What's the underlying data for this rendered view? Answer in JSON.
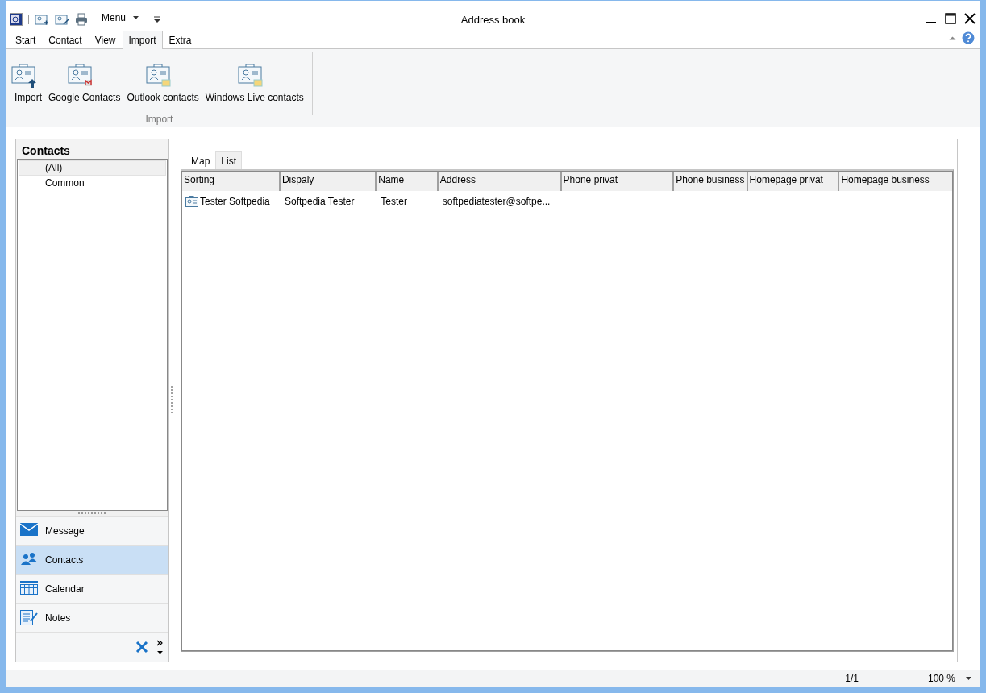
{
  "window": {
    "title": "Address book"
  },
  "quick_access": {
    "menu_label": "Menu"
  },
  "ribbon_tabs": [
    {
      "label": "Start",
      "selected": false
    },
    {
      "label": "Contact",
      "selected": false
    },
    {
      "label": "View",
      "selected": false
    },
    {
      "label": "Import",
      "selected": true
    },
    {
      "label": "Extra",
      "selected": false
    }
  ],
  "ribbon_group": {
    "label": "Import",
    "buttons": [
      {
        "label": "Import"
      },
      {
        "label": "Google Contacts"
      },
      {
        "label": "Outlook contacts"
      },
      {
        "label": "Windows Live contacts"
      }
    ]
  },
  "sidebar": {
    "title": "Contacts",
    "folders": [
      {
        "label": "(All)",
        "selected": true
      },
      {
        "label": "Common",
        "selected": false
      }
    ],
    "nav_items": [
      {
        "label": "Message",
        "selected": false
      },
      {
        "label": "Contacts",
        "selected": true
      },
      {
        "label": "Calendar",
        "selected": false
      },
      {
        "label": "Notes",
        "selected": false
      }
    ]
  },
  "view_tabs": [
    {
      "label": "Map",
      "selected": false
    },
    {
      "label": "List",
      "selected": true
    }
  ],
  "table": {
    "columns": [
      "Sorting",
      "Dispaly",
      "Name",
      "Address",
      "Phone privat",
      "Phone business",
      "Homepage privat",
      "Homepage business"
    ],
    "rows": [
      {
        "cells": [
          "Tester Softpedia",
          "Softpedia Tester",
          "Tester",
          "softpediatester@softpe..."
        ]
      }
    ]
  },
  "status_bar": {
    "page": "1/1",
    "zoom": "100 %"
  }
}
